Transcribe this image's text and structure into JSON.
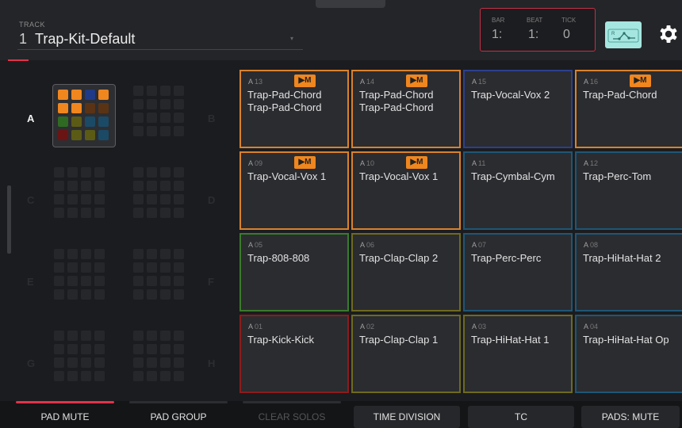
{
  "track": {
    "label": "TRACK",
    "number": "1",
    "name": "Trap-Kit-Default"
  },
  "counter": {
    "bar_label": "BAR",
    "bar_value": "1:",
    "beat_label": "BEAT",
    "beat_value": "1:",
    "tick_label": "TICK",
    "tick_value": "0"
  },
  "colors": {
    "accent_red": "#e0334b",
    "orange": "#f0861e",
    "automation": "#a6e6e0"
  },
  "banks": [
    {
      "letter": "A",
      "active": true
    },
    {
      "letter": "B",
      "active": false
    },
    {
      "letter": "C",
      "active": false
    },
    {
      "letter": "D",
      "active": false
    },
    {
      "letter": "E",
      "active": false
    },
    {
      "letter": "F",
      "active": false
    },
    {
      "letter": "G",
      "active": false
    },
    {
      "letter": "H",
      "active": false
    }
  ],
  "pads": [
    {
      "bank": "A",
      "number": "13",
      "name": "Trap-Pad-Chord\nTrap-Pad-Chord",
      "color": "#d9822b",
      "badge": "▶M"
    },
    {
      "bank": "A",
      "number": "14",
      "name": "Trap-Pad-Chord\nTrap-Pad-Chord",
      "color": "#d9822b",
      "badge": "▶M"
    },
    {
      "bank": "A",
      "number": "15",
      "name": "Trap-Vocal-Vox 2",
      "color": "#2c3f8e",
      "badge": ""
    },
    {
      "bank": "A",
      "number": "16",
      "name": "Trap-Pad-Chord",
      "color": "#d9822b",
      "badge": "▶M"
    },
    {
      "bank": "A",
      "number": "09",
      "name": "Trap-Vocal-Vox 1",
      "color": "#d9822b",
      "badge": "▶M"
    },
    {
      "bank": "A",
      "number": "10",
      "name": "Trap-Vocal-Vox 1",
      "color": "#d9822b",
      "badge": "▶M"
    },
    {
      "bank": "A",
      "number": "11",
      "name": "Trap-Cymbal-Cym",
      "color": "#1f5676",
      "badge": ""
    },
    {
      "bank": "A",
      "number": "12",
      "name": "Trap-Perc-Tom",
      "color": "#1f5676",
      "badge": ""
    },
    {
      "bank": "A",
      "number": "05",
      "name": "Trap-808-808",
      "color": "#3a7a2c",
      "badge": ""
    },
    {
      "bank": "A",
      "number": "06",
      "name": "Trap-Clap-Clap 2",
      "color": "#6e6a1f",
      "badge": ""
    },
    {
      "bank": "A",
      "number": "07",
      "name": "Trap-Perc-Perc",
      "color": "#1f5676",
      "badge": ""
    },
    {
      "bank": "A",
      "number": "08",
      "name": "Trap-HiHat-Hat 2",
      "color": "#1f5676",
      "badge": ""
    },
    {
      "bank": "A",
      "number": "01",
      "name": "Trap-Kick-Kick",
      "color": "#8b1c1c",
      "badge": ""
    },
    {
      "bank": "A",
      "number": "02",
      "name": "Trap-Clap-Clap 1",
      "color": "#6e6a1f",
      "badge": ""
    },
    {
      "bank": "A",
      "number": "03",
      "name": "Trap-HiHat-Hat 1",
      "color": "#6e6a1f",
      "badge": ""
    },
    {
      "bank": "A",
      "number": "04",
      "name": "Trap-HiHat-Hat Op",
      "color": "#1f5676",
      "badge": ""
    }
  ],
  "footer": [
    {
      "label": "PAD MUTE",
      "state": "selected"
    },
    {
      "label": "PAD GROUP",
      "state": "normal"
    },
    {
      "label": "CLEAR SOLOS",
      "state": "disabled"
    },
    {
      "label": "TIME DIVISION",
      "state": "boxed"
    },
    {
      "label": "TC",
      "state": "boxed"
    },
    {
      "label": "PADS: MUTE",
      "state": "boxed"
    }
  ]
}
